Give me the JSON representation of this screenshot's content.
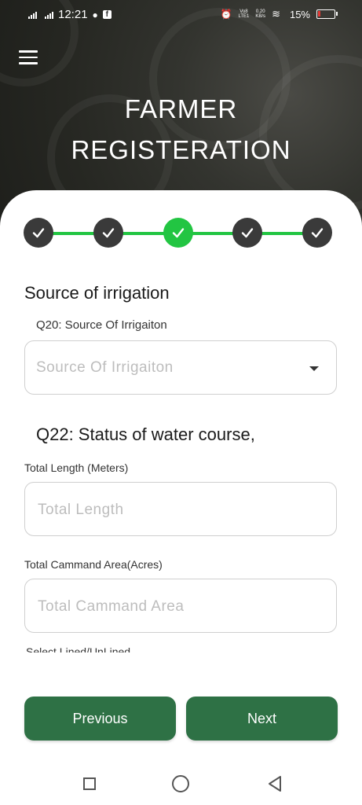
{
  "status_bar": {
    "time": "12:21",
    "network_top": "Vo8",
    "network_bottom": "LTE1",
    "speed_top": "0.20",
    "speed_bottom": "KB/s",
    "battery": "15%",
    "battery_color": "#e53935"
  },
  "header": {
    "title_line1": "FARMER",
    "title_line2": "REGISTERATION",
    "menu_icon": "hamburger-menu-icon"
  },
  "stepper": {
    "steps_total": 5,
    "active_step": 3,
    "complete_color": "#3a3a3a",
    "active_color": "#22c542"
  },
  "form": {
    "section_title": "Source of irrigation",
    "q20_label": "Q20: Source Of Irrigaiton",
    "q20_placeholder": "Source Of Irrigaiton",
    "q22_title": "Q22: Status of water course,",
    "total_length_label": "Total Length (Meters)",
    "total_length_placeholder": "Total Length",
    "command_area_label": "Total Cammand Area(Acres)",
    "command_area_placeholder": "Total Cammand Area",
    "lined_label": "Select Lined/UnLined"
  },
  "buttons": {
    "previous": "Previous",
    "next": "Next",
    "color": "#2e7145"
  },
  "nav": {
    "recent_icon": "square-icon",
    "home_icon": "circle-icon",
    "back_icon": "triangle-back-icon"
  }
}
